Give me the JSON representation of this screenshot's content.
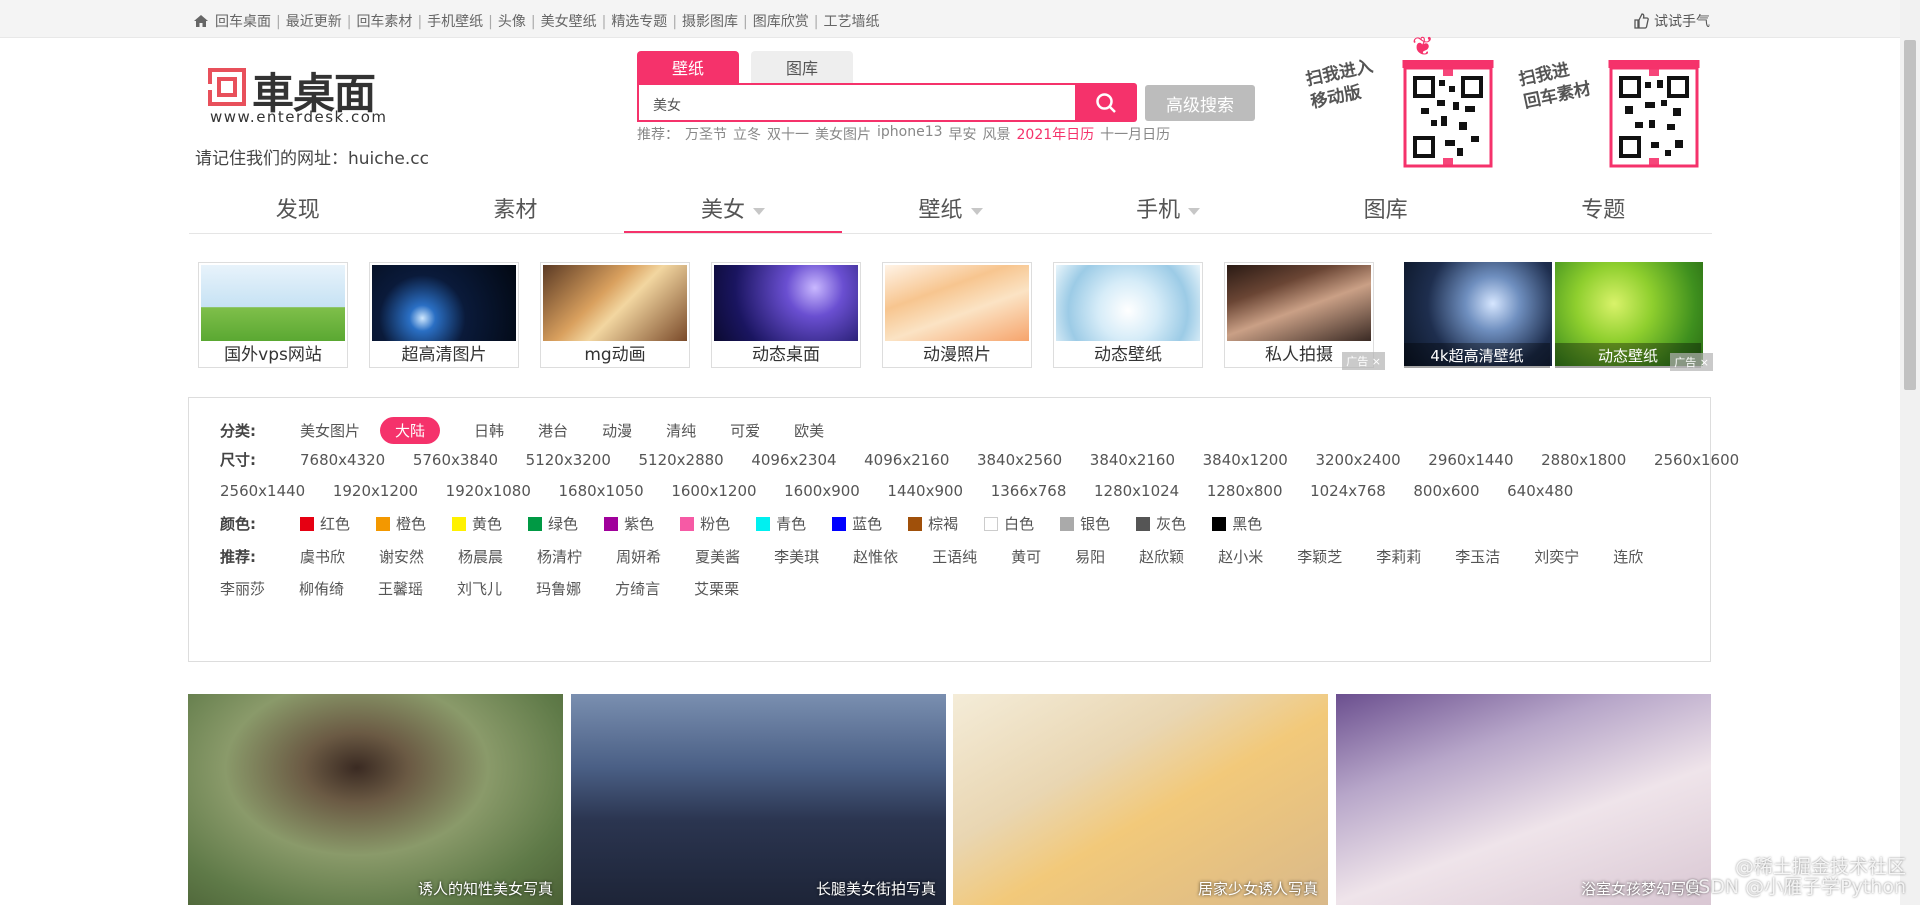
{
  "topbar": {
    "links": [
      "回车桌面",
      "最近更新",
      "回车素材",
      "手机壁纸",
      "头像",
      "美女壁纸",
      "精选专题",
      "摄影图库",
      "图库欣赏",
      "工艺墙纸"
    ],
    "try_hand": "试试手气"
  },
  "logo": {
    "cn": "車桌面",
    "en": "www.enterdesk.com"
  },
  "remember": "请记住我们的网址：huiche.cc",
  "search": {
    "tab_active": "壁纸",
    "tab_inactive": "图库",
    "query": "美女",
    "advanced": "高级搜索",
    "hot_prefix": "推荐：",
    "hot": [
      "万圣节",
      "立冬",
      "双十一",
      "美女图片",
      "iphone13",
      "早安",
      "风景"
    ],
    "hot_red": "2021年日历",
    "hot_last": "十一月日历"
  },
  "qr": {
    "mobile": "扫我进入\n移动版",
    "material": "扫我进\n回车素材"
  },
  "nav": [
    {
      "label": "发现",
      "caret": false,
      "active": false
    },
    {
      "label": "素材",
      "caret": false,
      "active": false
    },
    {
      "label": "美女",
      "caret": true,
      "active": true
    },
    {
      "label": "壁纸",
      "caret": true,
      "active": false
    },
    {
      "label": "手机",
      "caret": true,
      "active": false
    },
    {
      "label": "图库",
      "caret": false,
      "active": false
    },
    {
      "label": "专题",
      "caret": false,
      "active": false
    }
  ],
  "ads": [
    {
      "label": "国外vps网站"
    },
    {
      "label": "超高清图片"
    },
    {
      "label": "mg动画"
    },
    {
      "label": "动态桌面"
    },
    {
      "label": "动漫照片"
    },
    {
      "label": "动态壁纸"
    },
    {
      "label": "私人拍摄"
    },
    {
      "label": "4k超高清壁纸"
    },
    {
      "label": "动态壁纸"
    }
  ],
  "ad_tag": "广告",
  "filter": {
    "category_label": "分类:",
    "categories": [
      "美女图片",
      "大陆",
      "日韩",
      "港台",
      "动漫",
      "清纯",
      "可爱",
      "欧美"
    ],
    "category_active": "大陆",
    "size_label": "尺寸:",
    "sizes_row1": [
      "7680x4320",
      "5760x3840",
      "5120x3200",
      "5120x2880",
      "4096x2304",
      "4096x2160",
      "3840x2560",
      "3840x2160",
      "3840x1200",
      "3200x2400",
      "2960x1440",
      "2880x1800",
      "2560x1600"
    ],
    "sizes_row2": [
      "2560x1440",
      "1920x1200",
      "1920x1080",
      "1680x1050",
      "1600x1200",
      "1600x900",
      "1440x900",
      "1366x768",
      "1280x1024",
      "1280x800",
      "1024x768",
      "800x600",
      "640x480"
    ],
    "color_label": "颜色:",
    "colors": [
      {
        "name": "红色",
        "hex": "#e60012"
      },
      {
        "name": "橙色",
        "hex": "#f39800"
      },
      {
        "name": "黄色",
        "hex": "#fff100"
      },
      {
        "name": "绿色",
        "hex": "#009944"
      },
      {
        "name": "紫色",
        "hex": "#a0009b"
      },
      {
        "name": "粉色",
        "hex": "#f65aa5"
      },
      {
        "name": "青色",
        "hex": "#00f0f0"
      },
      {
        "name": "蓝色",
        "hex": "#0000ff"
      },
      {
        "name": "棕褐",
        "hex": "#a0500a"
      },
      {
        "name": "白色",
        "hex": "#ffffff"
      },
      {
        "name": "银色",
        "hex": "#aaaaaa"
      },
      {
        "name": "灰色",
        "hex": "#555555"
      },
      {
        "name": "黑色",
        "hex": "#000000"
      }
    ],
    "recommend_label": "推荐:",
    "recommend_row1": [
      "虞书欣",
      "谢安然",
      "杨晨晨",
      "杨清柠",
      "周妍希",
      "夏美酱",
      "李美琪",
      "赵惟依",
      "王语纯",
      "黄可",
      "易阳",
      "赵欣颖",
      "赵小米",
      "李颖芝",
      "李莉莉",
      "李玉洁",
      "刘奕宁",
      "连欣"
    ],
    "recommend_row2": [
      "李丽莎",
      "柳侑绮",
      "王馨瑶",
      "刘飞儿",
      "玛鲁娜",
      "方绮言",
      "艾栗栗"
    ]
  },
  "photos": [
    {
      "caption": "诱人的知性美女写真"
    },
    {
      "caption": "长腿美女街拍写真"
    },
    {
      "caption": "居家少女诱人写真"
    },
    {
      "caption": "浴室女孩梦幻写真"
    }
  ],
  "watermark": "@稀土掘金技术社区\nCSDN @小雁子学Python",
  "accent": "#f5326b"
}
